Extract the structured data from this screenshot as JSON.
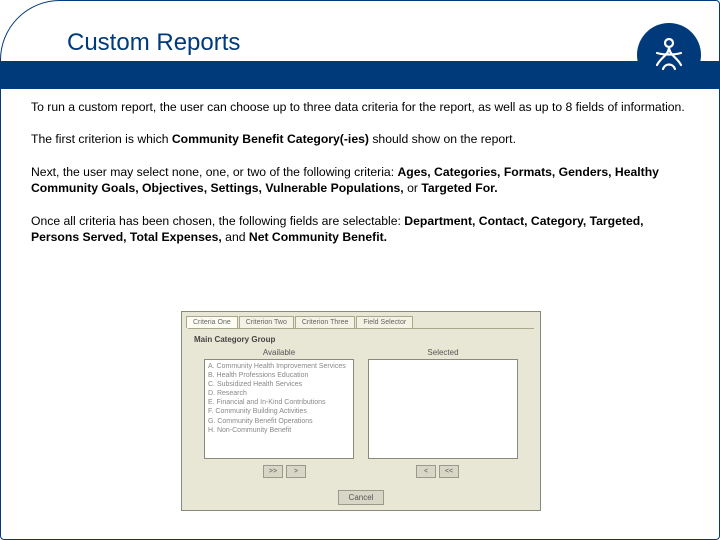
{
  "header": {
    "title": "Custom Reports"
  },
  "paragraphs": {
    "p1": "To run a custom report, the user can choose up to three data criteria for the report, as well as up to 8 fields of information.",
    "p2_pre": "The first criterion is which ",
    "p2_bold": "Community Benefit Category(-ies)",
    "p2_post": " should show on the report.",
    "p3_pre": "Next, the user may select none, one, or two of the following criteria: ",
    "p3_bold1": "Ages, Categories, Formats, Genders, Healthy Community Goals, Objectives, Settings, Vulnerable Populations,",
    "p3_mid": " or ",
    "p3_bold2": "Targeted For.",
    "p4_pre": "Once all criteria has been chosen, the following fields are selectable: ",
    "p4_bold1": "Department, Contact, Category, Targeted, Persons Served, Total Expenses,",
    "p4_mid": " and ",
    "p4_bold2": "Net Community Benefit."
  },
  "dialog": {
    "tabs": [
      "Criteria One",
      "Criterion Two",
      "Criterion Three",
      "Field Selector"
    ],
    "panel_title": "Main Category Group",
    "available_label": "Available",
    "selected_label": "Selected",
    "available_items": [
      "A. Community Health Improvement Services",
      "B. Health Professions Education",
      "C. Subsidized Health Services",
      "D. Research",
      "E. Financial and In-Kind Contributions",
      "F. Community Building Activities",
      "G. Community Benefit Operations",
      "H. Non-Community Benefit"
    ],
    "btn_add_all": ">>",
    "btn_add": ">",
    "btn_remove": "<",
    "btn_remove_all": "<<",
    "cancel": "Cancel"
  }
}
